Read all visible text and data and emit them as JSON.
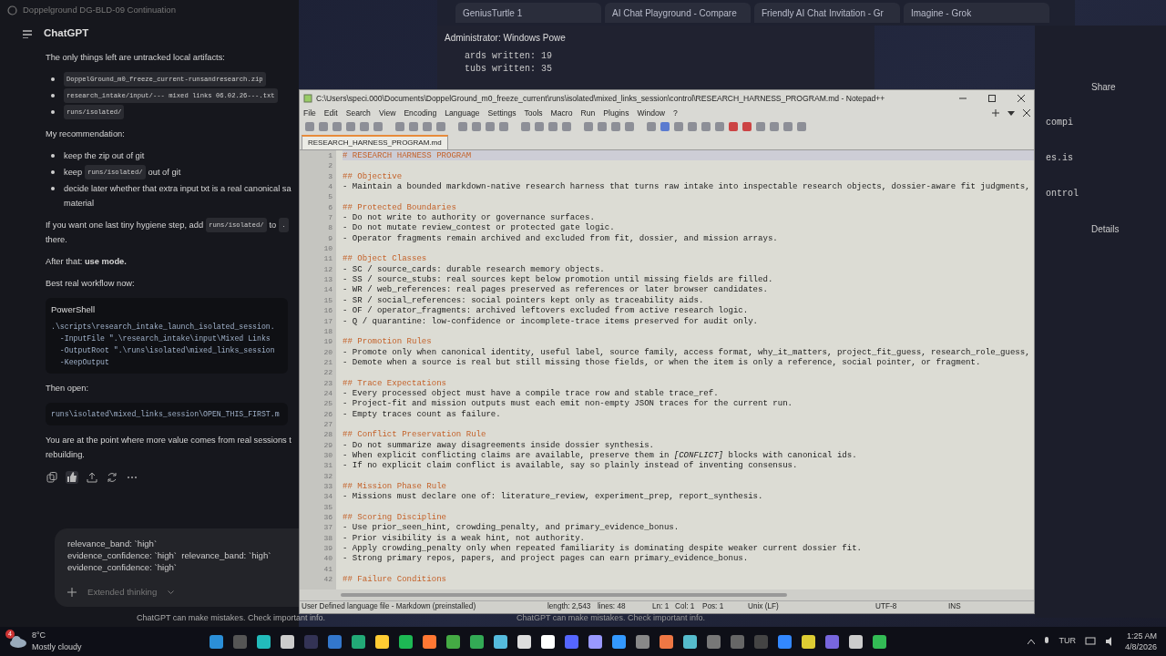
{
  "browser_tabs": [
    {
      "label": "GeniusTurtle 1",
      "selected": false
    },
    {
      "label": "AI Chat Playground - Compare",
      "selected": false
    },
    {
      "label": "Friendly AI Chat Invitation - Gr",
      "selected": false
    },
    {
      "label": "Imagine - Grok",
      "selected": false
    }
  ],
  "terminal": {
    "tab": "Administrator: Windows Powe",
    "lines": [
      "ards written: 19",
      "tubs written: 35"
    ]
  },
  "right_panel": {
    "share": "Share",
    "fragments": [
      "compi",
      "es.is",
      "ontrol"
    ],
    "details": "Details"
  },
  "chat": {
    "window_title": "Doppelground DG-BLD-09 Continuation",
    "model": "ChatGPT",
    "blocks": [
      {
        "kind": "para",
        "lines": [
          [
            {
              "kind": "text",
              "text": "The only things left are untracked local artifacts:"
            }
          ]
        ]
      },
      {
        "kind": "bullets",
        "items": [
          {
            "lines": [
              [
                {
                  "kind": "code",
                  "text": "DoppelGround_m0_freeze_current-runsandresearch.zip"
                }
              ]
            ]
          },
          {
            "lines": [
              [
                {
                  "kind": "code",
                  "text": "research_intake/input/--- mixed links 06.02.26---.txt"
                }
              ]
            ]
          },
          {
            "lines": [
              [
                {
                  "kind": "code",
                  "text": "runs/isolated/"
                }
              ]
            ]
          }
        ]
      },
      {
        "kind": "para",
        "lines": [
          [
            {
              "kind": "text",
              "text": "My recommendation:"
            }
          ]
        ]
      },
      {
        "kind": "bullets",
        "items": [
          {
            "lines": [
              [
                {
                  "kind": "text",
                  "text": "keep the zip out of git"
                }
              ]
            ]
          },
          {
            "lines": [
              [
                {
                  "kind": "text",
                  "text": "keep"
                },
                {
                  "kind": "code",
                  "text": "runs/isolated/"
                },
                {
                  "kind": "text",
                  "text": "out of git"
                }
              ]
            ]
          },
          {
            "lines": [
              [
                {
                  "kind": "text",
                  "text": "decide later whether that extra input txt is a real canonical sa"
                }
              ],
              [
                {
                  "kind": "text",
                  "text": "material"
                }
              ]
            ]
          }
        ]
      },
      {
        "kind": "para",
        "lines": [
          [
            {
              "kind": "text",
              "text": "If you want one last tiny hygiene step, add"
            },
            {
              "kind": "code",
              "text": "runs/isolated/"
            },
            {
              "kind": "text",
              "text": "to"
            },
            {
              "kind": "code",
              "text": "."
            }
          ],
          [
            {
              "kind": "text",
              "text": "there."
            }
          ]
        ]
      },
      {
        "kind": "para",
        "lines": [
          [
            {
              "kind": "text",
              "text": "After that: **use mode.**"
            }
          ]
        ]
      },
      {
        "kind": "para",
        "lines": [
          [
            {
              "kind": "text",
              "text": "Best real workflow now:"
            }
          ]
        ]
      },
      {
        "kind": "code",
        "label": "PowerShell",
        "lines": [
          ".\\scripts\\research_intake_launch_isolated_session.",
          "  -InputFile \".\\research_intake\\input\\Mixed Links ",
          "  -OutputRoot \".\\runs\\isolated\\mixed_links_session",
          "  -KeepOutput"
        ]
      },
      {
        "kind": "para",
        "lines": [
          [
            {
              "kind": "text",
              "text": "Then open:"
            }
          ]
        ]
      },
      {
        "kind": "code",
        "lines": [
          "runs\\isolated\\mixed_links_session\\OPEN_THIS_FIRST.m"
        ]
      },
      {
        "kind": "para",
        "lines": [
          [
            {
              "kind": "text",
              "text": "You are at the point where more value comes from real sessions t"
            }
          ],
          [
            {
              "kind": "text",
              "text": "rebuilding."
            }
          ]
        ]
      }
    ],
    "liked": true,
    "input_lines": [
      "relevance_band: `high`",
      "evidence_confidence: `high`  relevance_band: `high`",
      "evidence_confidence: `high`"
    ],
    "mode": "Extended thinking",
    "footer": "ChatGPT can make mistakes. Check important info."
  },
  "footer_behind": "ChatGPT can make mistakes. Check important info.",
  "notepad": {
    "title": "C:\\Users\\speci.000\\Documents\\DoppelGround_m0_freeze_current\\runs\\isolated\\mixed_links_session\\control\\RESEARCH_HARNESS_PROGRAM.md - Notepad++",
    "menu": [
      "File",
      "Edit",
      "Search",
      "View",
      "Encoding",
      "Language",
      "Settings",
      "Tools",
      "Macro",
      "Run",
      "Plugins",
      "Window",
      "?"
    ],
    "tabs": [
      {
        "label": "RESEARCH_HARNESS_PROGRAM.md",
        "selected": true
      }
    ],
    "lines": [
      {
        "n": "1",
        "kind": "title",
        "text": "# RESEARCH HARNESS PROGRAM"
      },
      {
        "n": "2",
        "kind": "blank"
      },
      {
        "n": "3",
        "kind": "heading",
        "text": "## Objective"
      },
      {
        "n": "4",
        "kind": "item",
        "text": "- Maintain a bounded markdown-native research harness that turns raw intake into inspectable research objects, dossier-aware fit judgments,"
      },
      {
        "n": "5",
        "kind": "blank"
      },
      {
        "n": "6",
        "kind": "heading",
        "text": "## Protected Boundaries"
      },
      {
        "n": "7",
        "kind": "item",
        "text": "- Do not write to authority or governance surfaces."
      },
      {
        "n": "8",
        "kind": "item",
        "text": "- Do not mutate review_contest or protected gate logic."
      },
      {
        "n": "9",
        "kind": "item",
        "text": "- Operator fragments remain archived and excluded from fit, dossier, and mission arrays."
      },
      {
        "n": "10",
        "kind": "blank"
      },
      {
        "n": "11",
        "kind": "heading",
        "text": "## Object Classes"
      },
      {
        "n": "12",
        "kind": "item",
        "text": "- SC / source_cards: durable research memory objects."
      },
      {
        "n": "13",
        "kind": "item",
        "text": "- SS / source_stubs: real sources kept below promotion until missing fields are filled."
      },
      {
        "n": "14",
        "kind": "item",
        "text": "- WR / web_references: real pages preserved as references or later browser candidates."
      },
      {
        "n": "15",
        "kind": "item",
        "text": "- SR / social_references: social pointers kept only as traceability aids."
      },
      {
        "n": "16",
        "kind": "item",
        "text": "- OF / operator_fragments: archived leftovers excluded from active research logic."
      },
      {
        "n": "17",
        "kind": "item",
        "text": "- Q / quarantine: low-confidence or incomplete-trace items preserved for audit only."
      },
      {
        "n": "18",
        "kind": "blank"
      },
      {
        "n": "19",
        "kind": "heading",
        "text": "## Promotion Rules"
      },
      {
        "n": "20",
        "kind": "item",
        "text": "- Promote only when canonical identity, useful label, source family, access format, why_it_matters, project_fit_guess, research_role_guess,"
      },
      {
        "n": "21",
        "kind": "item",
        "text": "- Demote when a source is real but still missing those fields, or when the item is only a reference, social pointer, or fragment."
      },
      {
        "n": "22",
        "kind": "blank"
      },
      {
        "n": "23",
        "kind": "heading",
        "text": "## Trace Expectations"
      },
      {
        "n": "24",
        "kind": "item",
        "text": "- Every processed object must have a compile trace row and stable trace_ref."
      },
      {
        "n": "25",
        "kind": "item",
        "text": "- Project-fit and mission outputs must each emit non-empty JSON traces for the current run."
      },
      {
        "n": "26",
        "kind": "item",
        "text": "- Empty traces count as failure."
      },
      {
        "n": "27",
        "kind": "blank"
      },
      {
        "n": "28",
        "kind": "heading",
        "text": "## Conflict Preservation Rule"
      },
      {
        "n": "29",
        "kind": "item",
        "text": "- Do not summarize away disagreements inside dossier synthesis."
      },
      {
        "n": "30",
        "kind": "item",
        "text": "- When explicit conflicting claims are available, preserve them in *[CONFLICT]* blocks with canonical ids."
      },
      {
        "n": "31",
        "kind": "item",
        "text": "- If no explicit claim conflict is available, say so plainly instead of inventing consensus."
      },
      {
        "n": "32",
        "kind": "blank"
      },
      {
        "n": "33",
        "kind": "heading",
        "text": "## Mission Phase Rule"
      },
      {
        "n": "34",
        "kind": "item",
        "text": "- Missions must declare one of: literature_review, experiment_prep, report_synthesis."
      },
      {
        "n": "35",
        "kind": "blank"
      },
      {
        "n": "36",
        "kind": "heading",
        "text": "## Scoring Discipline"
      },
      {
        "n": "37",
        "kind": "item",
        "text": "- Use prior_seen_hint, crowding_penalty, and primary_evidence_bonus."
      },
      {
        "n": "38",
        "kind": "item",
        "text": "- Prior visibility is a weak hint, not authority."
      },
      {
        "n": "39",
        "kind": "item",
        "text": "- Apply crowding_penalty only when repeated familiarity is dominating despite weaker current dossier fit."
      },
      {
        "n": "40",
        "kind": "item",
        "text": "- Strong primary repos, papers, and project pages can earn primary_evidence_bonus."
      },
      {
        "n": "41",
        "kind": "blank"
      },
      {
        "n": "42",
        "kind": "heading",
        "text": "## Failure Conditions"
      }
    ],
    "status": [
      "User Defined language file - Markdown (preinstalled)",
      "length: 2,543",
      "lines: 48",
      "Ln: 1",
      "Col: 1",
      "Pos: 1",
      "Unix (LF)",
      "UTF-8",
      "INS"
    ]
  },
  "taskbar": {
    "weather_badge": "4",
    "temperature": "8°C",
    "weather": "Mostly cloudy",
    "language": "TUR",
    "time": "1:25 AM",
    "date": "4/8/2026"
  }
}
